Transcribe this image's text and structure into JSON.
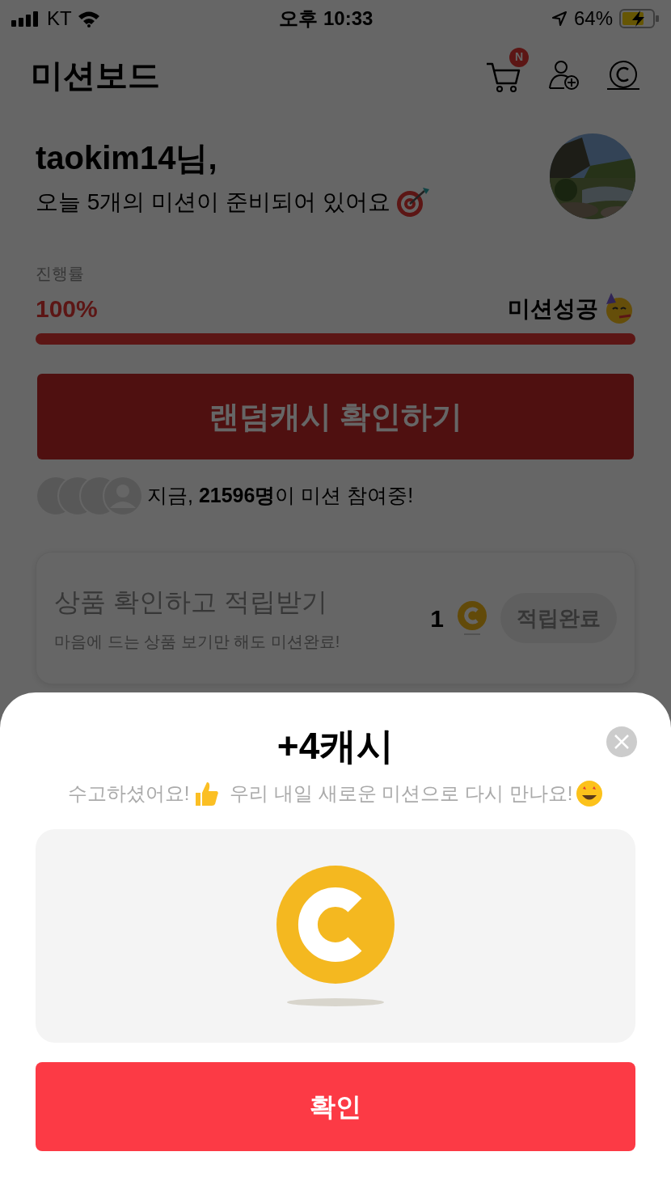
{
  "status_bar": {
    "carrier": "KT",
    "time": "오후 10:33",
    "battery": "64%"
  },
  "header": {
    "title": "미션보드",
    "cart_badge": "N"
  },
  "greeting": {
    "name": "taokim14님,",
    "message": "오늘 5개의 미션이 준비되어 있어요"
  },
  "progress": {
    "label": "진행률",
    "percent": "100%",
    "status": "미션성공",
    "level": 1
  },
  "random_cash_button": "랜덤캐시 확인하기",
  "participants": {
    "text": "지금, **21596명**이 미션 참여중!"
  },
  "mission_card": {
    "title": "상품 확인하고 적립받기",
    "subtitle": "마음에 드는 상품 보기만 해도 미션완료!",
    "reward": "1",
    "button": "적립완료",
    "disabled": true
  },
  "reward_sheet": {
    "title": "+4캐시",
    "message_parts": [
      "수고하셨어요!",
      "우리 내일 새로운 미션으로 다시 만나요!"
    ],
    "confirm": "확인"
  }
}
